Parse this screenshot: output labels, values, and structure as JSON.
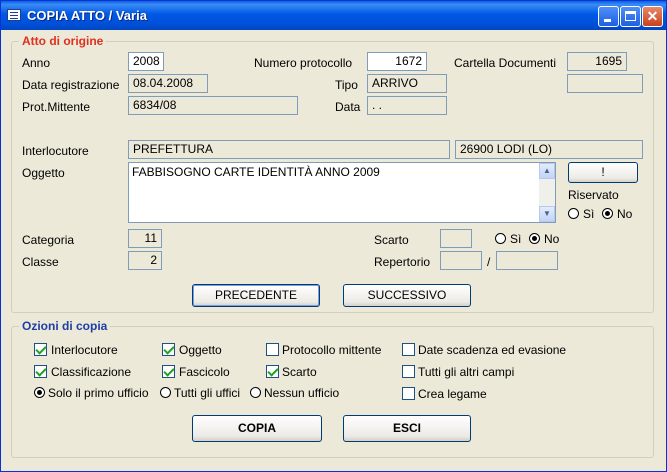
{
  "window": {
    "title": "COPIA ATTO / Varia"
  },
  "origin": {
    "legend": "Atto di origine",
    "anno_label": "Anno",
    "anno_value": "2008",
    "numero_label": "Numero protocollo",
    "numero_value": "1672",
    "cartella_label": "Cartella Documenti",
    "cartella_value": "1695",
    "data_reg_label": "Data registrazione",
    "data_reg_value": "08.04.2008",
    "tipo_label": "Tipo",
    "tipo_value": "ARRIVO",
    "prot_mitt_label": "Prot.Mittente",
    "prot_mitt_value": "6834/08",
    "data_label": "Data",
    "data_value": " .  .",
    "interlocutore_label": "Interlocutore",
    "interlocutore_value": "PREFETTURA",
    "interlocutore_city": "26900 LODI (LO)",
    "oggetto_label": "Oggetto",
    "oggetto_value": "FABBISOGNO CARTE IDENTITÀ ANNO 2009",
    "excl_button": "!",
    "riservato_label": "Riservato",
    "riservato_si": "Sì",
    "riservato_no": "No",
    "categoria_label": "Categoria",
    "categoria_value": "11",
    "classe_label": "Classe",
    "classe_value": "2",
    "scarto_label": "Scarto",
    "scarto_si": "Sì",
    "scarto_no": "No",
    "repertorio_label": "Repertorio",
    "repertorio_sep": "/",
    "prev_button": "PRECEDENTE",
    "next_button": "SUCCESSIVO"
  },
  "options": {
    "legend": "Ozioni di copia",
    "interlocutore": "Interlocutore",
    "oggetto": "Oggetto",
    "protocollo_mittente": "Protocollo mittente",
    "date_scadenza": "Date scadenza ed evasione",
    "classificazione": "Classificazione",
    "fascicolo": "Fascicolo",
    "scarto": "Scarto",
    "tutti_campi": "Tutti gli altri campi",
    "solo_primo": "Solo il primo ufficio",
    "tutti_uffici": "Tutti gli uffici",
    "nessun_ufficio": "Nessun ufficio",
    "crea_legame": "Crea legame",
    "copia_button": "COPIA",
    "esci_button": "ESCI"
  }
}
